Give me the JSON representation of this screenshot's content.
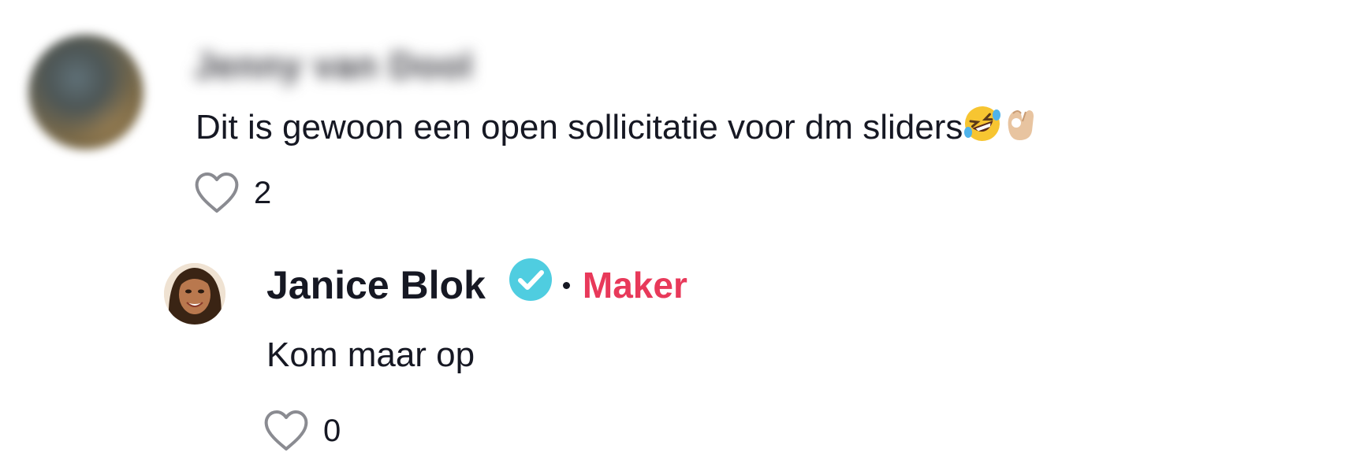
{
  "comments": [
    {
      "username": "Jenny van Dool",
      "text": "Dit is gewoon een open sollicitatie voor dm sliders",
      "emojis": [
        "🤣",
        "👌🏼"
      ],
      "likes": "2"
    }
  ],
  "reply": {
    "username": "Janice Blok",
    "verified": true,
    "separator": "·",
    "role_badge": "Maker",
    "text": "Kom maar op",
    "likes": "0"
  },
  "colors": {
    "text": "#161823",
    "verified": "#20d5ec",
    "maker": "#e8395a",
    "heart_outline": "#8a8b91"
  },
  "icons": {
    "like": "heart-outline-icon",
    "verified": "verified-check-icon"
  }
}
